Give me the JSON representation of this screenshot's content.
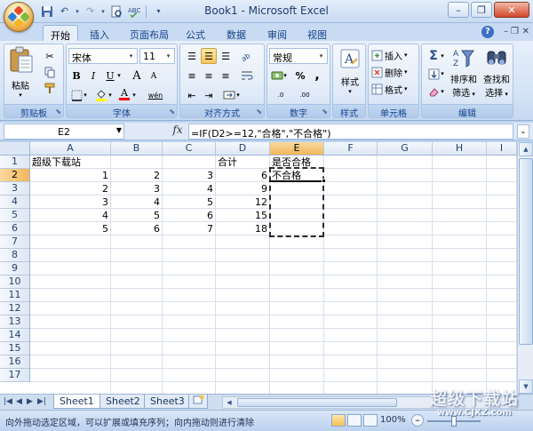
{
  "window": {
    "title": "Book1 - Microsoft Excel"
  },
  "quick_access": {
    "icons": [
      "save-icon",
      "undo-icon",
      "redo-icon",
      "print-preview-icon",
      "customize-icon"
    ]
  },
  "tabs": [
    "开始",
    "插入",
    "页面布局",
    "公式",
    "数据",
    "审阅",
    "视图"
  ],
  "active_tab": "开始",
  "ribbon": {
    "clipboard": {
      "label": "剪贴板",
      "paste": "粘贴"
    },
    "font": {
      "label": "字体",
      "name": "宋体",
      "size": "11",
      "bold": "B",
      "italic": "I",
      "underline": "U",
      "grow": "A",
      "shrink": "A",
      "color_glyph": "A",
      "phonetic": "wén"
    },
    "alignment": {
      "label": "对齐方式"
    },
    "number": {
      "label": "数字",
      "format": "常规",
      "percent": "%",
      "comma": ",",
      "inc_decimal": ".0",
      "dec_decimal": ".00"
    },
    "styles": {
      "label": "样式"
    },
    "cells": {
      "label": "单元格",
      "insert": "插入",
      "delete": "删除",
      "format": "格式"
    },
    "editing": {
      "label": "编辑",
      "sort_filter_1": "排序和",
      "sort_filter_2": "筛选",
      "find_select_1": "查找和",
      "find_select_2": "选择"
    }
  },
  "formula_bar": {
    "name_box": "E2",
    "fx": "fx",
    "formula": "=IF(D2>=12,\"合格\",\"不合格\")"
  },
  "columns": [
    "A",
    "B",
    "C",
    "D",
    "E",
    "F",
    "G",
    "H",
    "I"
  ],
  "rows": [
    "1",
    "2",
    "3",
    "4",
    "5",
    "6",
    "7",
    "8",
    "9",
    "10",
    "11",
    "12",
    "13",
    "14",
    "15",
    "16",
    "17"
  ],
  "cells": {
    "A1": "超级下载站",
    "D1": "合计",
    "E1": "是否合格",
    "E2": "不合格",
    "A2": "1",
    "B2": "2",
    "C2": "3",
    "D2": "6",
    "A3": "2",
    "B3": "3",
    "C3": "4",
    "D3": "9",
    "A4": "3",
    "B4": "4",
    "C4": "5",
    "D4": "12",
    "A5": "4",
    "B5": "5",
    "C5": "6",
    "D5": "15",
    "A6": "5",
    "B6": "6",
    "C6": "7",
    "D6": "18"
  },
  "sheets": [
    "Sheet1",
    "Sheet2",
    "Sheet3"
  ],
  "active_sheet": "Sheet1",
  "status": {
    "message": "向外拖动选定区域，可以扩展或填充序列；向内拖动则进行清除",
    "zoom": "100%"
  },
  "watermark": {
    "line1": "超级下载站",
    "line2": "www.CJXZ.com"
  },
  "colors": {
    "accent": "#15428b",
    "ribbon_bg": "#d3e2f5",
    "selected_header": "#f2b65a"
  }
}
